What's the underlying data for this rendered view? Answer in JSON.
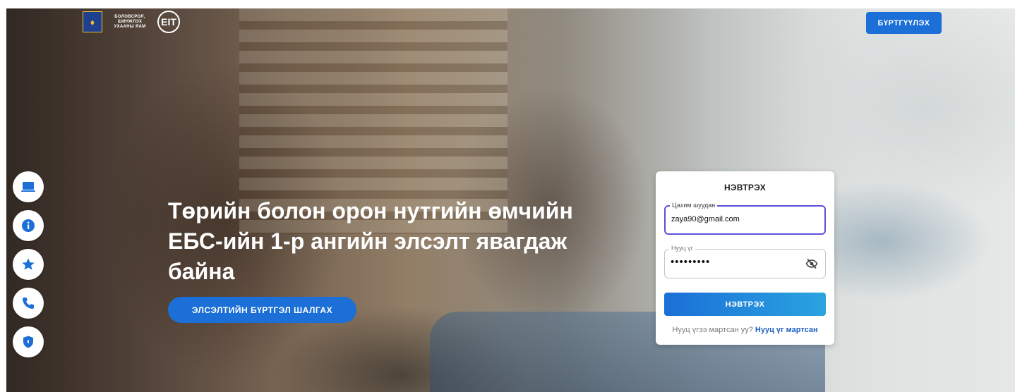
{
  "header": {
    "ministry_name": "БОЛОВСРОЛ, ШИНЖЛЭХ УХААНЫ ЯАМ",
    "register_label": "БҮРТГҮҮЛЭХ"
  },
  "hero": {
    "headline": "Төрийн болон орон нутгийн өмчийн ЕБС-ийн 1-р ангийн элсэлт явагдаж байна",
    "check_button_label": "ЭЛСЭЛТИЙН БҮРТГЭЛ ШАЛГАХ"
  },
  "side_menu": {
    "items": [
      "laptop-icon",
      "info-icon",
      "star-icon",
      "phone-icon",
      "shield-icon"
    ]
  },
  "login": {
    "title": "НЭВТРЭХ",
    "email_label": "Цахим шуудан",
    "email_value": "zaya90@gmail.com",
    "password_label": "Нууц үг",
    "password_value": "•••••••••",
    "submit_label": "НЭВТРЭХ",
    "forgot_question": "Нууц үгээ мартсан уу?",
    "forgot_link": "Нууц үг мартсан"
  },
  "colors": {
    "primary": "#1b6fd6",
    "focus_border": "#5b51d8",
    "link": "#1b5fc2"
  }
}
